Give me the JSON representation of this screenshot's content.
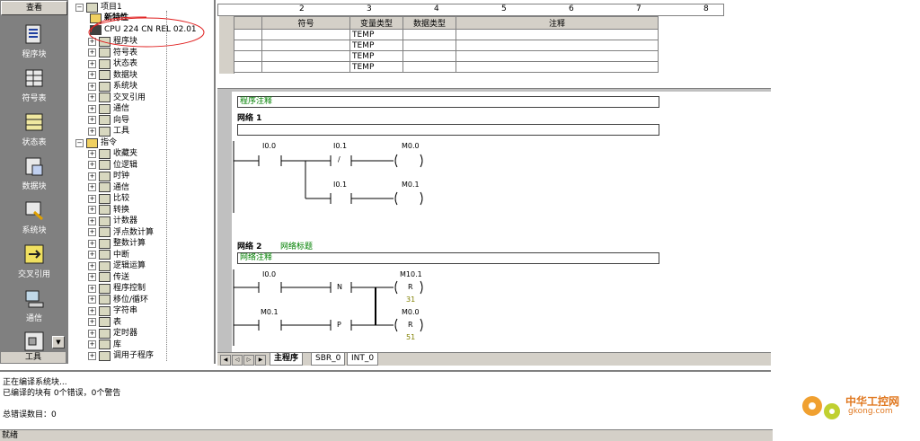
{
  "nav": {
    "header": "查看",
    "items": [
      {
        "label": "程序块",
        "icon": "program-block-icon"
      },
      {
        "label": "符号表",
        "icon": "symbol-table-icon"
      },
      {
        "label": "状态表",
        "icon": "status-table-icon"
      },
      {
        "label": "数据块",
        "icon": "data-block-icon"
      },
      {
        "label": "系统块",
        "icon": "system-block-icon"
      },
      {
        "label": "交叉引用",
        "icon": "cross-reference-icon"
      },
      {
        "label": "通信",
        "icon": "communication-icon"
      },
      {
        "label": "工具",
        "icon": "tools-icon"
      }
    ]
  },
  "tree": {
    "project": "项目1",
    "new_feature": "新特性",
    "cpu": "CPU 224 CN REL 02.01",
    "project_items": [
      "程序块",
      "符号表",
      "状态表",
      "数据块",
      "系统块",
      "交叉引用",
      "通信",
      "向导",
      "工具"
    ],
    "instructions": "指令",
    "instruction_items": [
      "收藏夹",
      "位逻辑",
      "时钟",
      "通信",
      "比较",
      "转换",
      "计数器",
      "浮点数计算",
      "整数计算",
      "中断",
      "逻辑运算",
      "传送",
      "程序控制",
      "移位/循环",
      "字符串",
      "表",
      "定时器",
      "库",
      "调用子程序"
    ]
  },
  "ruler": {
    "marks": [
      "2",
      "3",
      "4",
      "5",
      "6",
      "7",
      "8"
    ]
  },
  "var_table": {
    "headers": [
      "符号",
      "变量类型",
      "数据类型",
      "注释"
    ],
    "rows": [
      "TEMP",
      "TEMP",
      "TEMP",
      "TEMP"
    ]
  },
  "editor": {
    "program_comment": "程序注释",
    "network1": {
      "title": "网络 1",
      "contacts": [
        "I0.0",
        "I0.1",
        "I0.1"
      ],
      "coils": [
        "M0.0",
        "M0.1"
      ],
      "slash": "/"
    },
    "network2": {
      "title": "网络 2",
      "subtitle": "网络标题",
      "comment": "网络注释",
      "contacts": [
        "I0.0",
        "M0.1"
      ],
      "edge": [
        "N",
        "P"
      ],
      "coils": [
        {
          "addr": "M10.1",
          "type": "R",
          "n": "31"
        },
        {
          "addr": "M0.0",
          "type": "R",
          "n": "51"
        }
      ]
    }
  },
  "tabs": [
    "主程序",
    "SBR_0",
    "INT_0"
  ],
  "output": {
    "line1": "正在编译系统块...",
    "line2": "已编译的块有 0个错误，0个警告",
    "line3": "总错误数目：0"
  },
  "status": "就绪",
  "watermark": {
    "text1": "中华工控网",
    "text2": "gkong.com"
  },
  "colors": {
    "accent_green": "#008000",
    "annotation_red": "#e02020"
  }
}
